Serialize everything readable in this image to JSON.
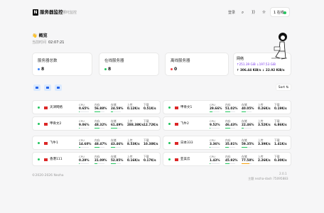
{
  "header": {
    "logo_letter": "N",
    "title": "服务器监控",
    "subtitle": "哪吒监控",
    "login_label": "登录",
    "online_label": "在线",
    "online_prefix": "1"
  },
  "overview": {
    "greeting": "概览",
    "greeting_icon": "👋",
    "time_label": "当前时间",
    "time_value": "02:07:21"
  },
  "stats": [
    {
      "label": "服务器总数",
      "value": "8",
      "color": "#3b82f6"
    },
    {
      "label": "在线服务器",
      "value": "8",
      "color": "#22c55e"
    },
    {
      "label": "离线服务器",
      "value": "0",
      "color": "#ef4444"
    }
  ],
  "network": {
    "label": "网络",
    "traffic": "↑251.39 GiB ↓197.53 GiB",
    "speed": "↑ 306.44 KiB/s  ↓ 22.92 KiB/s"
  },
  "sort_label": "Sort ⇅",
  "metric_labels": {
    "cpu": "CPU",
    "mem": "内存",
    "disk": "存储",
    "up": "上传",
    "down": "下载"
  },
  "servers": [
    {
      "name": "天津网络",
      "cpu": "0.65%",
      "mem": "56.88%",
      "disk": "24.59%",
      "up": "0.12K/s",
      "down": "0.51K/s",
      "cpu_p": 0.0065,
      "mem_p": 0.5688,
      "disk_p": 0.2459
    },
    {
      "name": "甲骨文1",
      "cpu": "29.66%",
      "mem": "51.02%",
      "disk": "40.05%",
      "up": "0.26K/s",
      "down": "0.19K/s",
      "cpu_p": 0.2966,
      "mem_p": 0.5102,
      "disk_p": 0.4005
    },
    {
      "name": "甲骨文2",
      "cpu": "9.06%",
      "mem": "48.32%",
      "disk": "61.49%",
      "up": "288.38K/s",
      "down": "12.72K/s",
      "cpu_p": 0.0906,
      "mem_p": 0.4832,
      "disk_p": 0.6149
    },
    {
      "name": "飞牛2",
      "cpu": "9.52%",
      "mem": "46.43%",
      "disk": "22.46%",
      "up": "3.52K/s",
      "down": "6.86K/s",
      "cpu_p": 0.0952,
      "mem_p": 0.4643,
      "disk_p": 0.2246
    },
    {
      "name": "飞牛1",
      "cpu": "14.60%",
      "mem": "48.47%",
      "disk": "43.46%",
      "up": "8.53K/s",
      "down": "10.38K/s",
      "cpu_p": 0.146,
      "mem_p": 0.4847,
      "disk_p": 0.4346
    },
    {
      "name": "日本333",
      "cpu": "3.36%",
      "mem": "35.81%",
      "disk": "59.35%",
      "up": "3.39K/s",
      "down": "1.41K/s",
      "cpu_p": 0.0336,
      "mem_p": 0.3581,
      "disk_p": 0.5935
    },
    {
      "name": "香港111",
      "cpu": "0.29%",
      "mem": "31.09%",
      "disk": "52.85%",
      "up": "0.16K/s",
      "down": "0.17K/s",
      "cpu_p": 0.0029,
      "mem_p": 0.3109,
      "disk_p": 0.5285
    },
    {
      "name": "亚美云",
      "cpu": "1.43%",
      "mem": "45.92%",
      "disk": "77.58%",
      "up": "2.26K/s",
      "down": "0.30K/s",
      "cpu_p": 0.0143,
      "mem_p": 0.4592,
      "disk_p": 0.7758
    }
  ],
  "footer": {
    "copyright": "©2020-2026 Nezha",
    "version": "2.0.1",
    "build": "主题 nezha-dash 75095883"
  }
}
